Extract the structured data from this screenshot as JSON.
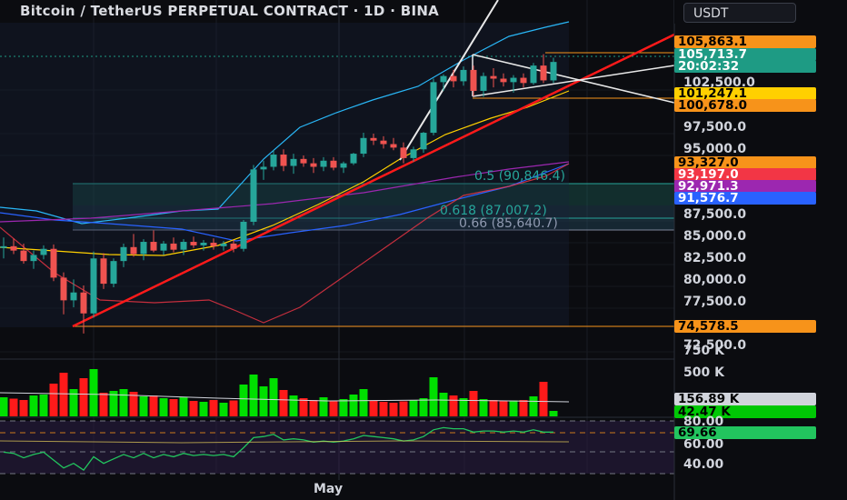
{
  "title": "Bitcoin / TetherUS PERPETUAL CONTRACT · 1D · BINA",
  "currency_button": "USDT",
  "x_labels": [
    "May"
  ],
  "fib_labels": [
    {
      "text": "0.5 (90,846.4)",
      "color": "#26a69a"
    },
    {
      "text": "0.618 (87,007.2)",
      "color": "#26a69a"
    },
    {
      "text": "0.66 (85,640.7)",
      "color": "#8f99b0"
    }
  ],
  "price_axis": {
    "ticks": [
      "102,500.0",
      "97,500.0",
      "95,000.0",
      "87,500.0",
      "85,000.0",
      "82,500.0",
      "80,000.0",
      "77,500.0",
      "72,500.0"
    ],
    "tags": [
      {
        "text": "105,863.1",
        "bg": "#f7931a",
        "fg": "#000000"
      },
      {
        "text": "105,713.7",
        "bg": "#1e9b84",
        "fg": "#ffffff"
      },
      {
        "text": "20:02:32",
        "bg": "#1e9b84",
        "fg": "#ffffff"
      },
      {
        "text": "101,247.1",
        "bg": "#ffd000",
        "fg": "#000000"
      },
      {
        "text": "100,678.0",
        "bg": "#f7931a",
        "fg": "#000000"
      },
      {
        "text": "93,327.0",
        "bg": "#f7931a",
        "fg": "#000000"
      },
      {
        "text": "93,197.0",
        "bg": "#f23645",
        "fg": "#ffffff"
      },
      {
        "text": "92,971.3",
        "bg": "#9c27b0",
        "fg": "#ffffff"
      },
      {
        "text": "91,576.7",
        "bg": "#2962ff",
        "fg": "#ffffff"
      },
      {
        "text": "74,578.5",
        "bg": "#f7931a",
        "fg": "#000000"
      }
    ]
  },
  "volume_axis": {
    "ticks": [
      "750 K",
      "500 K"
    ],
    "tags": [
      {
        "text": "156.89 K",
        "bg": "#d1d4dc",
        "fg": "#000000"
      },
      {
        "text": "42.47 K",
        "bg": "#00c805",
        "fg": "#000000"
      }
    ]
  },
  "rsi_axis": {
    "ticks": [
      "80.00",
      "60.00",
      "40.00"
    ],
    "tags": [
      {
        "text": "69.66",
        "bg": "#22c55e",
        "fg": "#000000"
      }
    ]
  },
  "chart_data": {
    "type": "candlestick",
    "title": "Bitcoin / TetherUS PERPETUAL CONTRACT · 1D · BINA",
    "y_unit": "USDT",
    "ylim": [
      72500,
      108000
    ],
    "candles": [
      [
        84400,
        85600,
        83200,
        84600
      ],
      [
        84600,
        85500,
        83700,
        84100
      ],
      [
        84100,
        84900,
        82600,
        82900
      ],
      [
        82900,
        84100,
        82000,
        83600
      ],
      [
        83600,
        84700,
        83100,
        84300
      ],
      [
        84300,
        84800,
        80600,
        81000
      ],
      [
        81000,
        81600,
        76800,
        78400
      ],
      [
        78400,
        80800,
        77600,
        79300
      ],
      [
        79300,
        80100,
        74600,
        76900
      ],
      [
        76900,
        84000,
        76400,
        83200
      ],
      [
        83200,
        83800,
        79700,
        80300
      ],
      [
        80300,
        83200,
        79900,
        82900
      ],
      [
        82900,
        84900,
        82200,
        84500
      ],
      [
        84500,
        86000,
        83400,
        83700
      ],
      [
        83700,
        85400,
        83000,
        85100
      ],
      [
        85100,
        86400,
        83900,
        84100
      ],
      [
        84100,
        85200,
        83600,
        84900
      ],
      [
        84900,
        85600,
        83900,
        84200
      ],
      [
        84200,
        85400,
        83600,
        85100
      ],
      [
        85100,
        85700,
        84400,
        84700
      ],
      [
        84700,
        85300,
        84100,
        85000
      ],
      [
        85000,
        85500,
        84200,
        84600
      ],
      [
        84600,
        85200,
        84100,
        84900
      ],
      [
        84900,
        85300,
        83900,
        84300
      ],
      [
        84300,
        87600,
        84000,
        87400
      ],
      [
        87400,
        93900,
        87000,
        93400
      ],
      [
        93400,
        94400,
        92200,
        93700
      ],
      [
        93700,
        95600,
        93300,
        95100
      ],
      [
        95100,
        95700,
        93200,
        93800
      ],
      [
        93800,
        95200,
        92900,
        94600
      ],
      [
        94600,
        95000,
        93700,
        94100
      ],
      [
        94100,
        94700,
        93000,
        93700
      ],
      [
        93700,
        94800,
        93200,
        94400
      ],
      [
        94400,
        94800,
        93300,
        93600
      ],
      [
        93600,
        94300,
        93000,
        94100
      ],
      [
        94100,
        95300,
        93900,
        95200
      ],
      [
        95200,
        97600,
        94800,
        97000
      ],
      [
        97000,
        97500,
        96200,
        96700
      ],
      [
        96700,
        97200,
        95800,
        96300
      ],
      [
        96300,
        97000,
        95600,
        95900
      ],
      [
        95900,
        96500,
        94100,
        94700
      ],
      [
        94700,
        96000,
        94300,
        95700
      ],
      [
        95700,
        97700,
        95300,
        97600
      ],
      [
        97600,
        103800,
        97300,
        103400
      ],
      [
        103400,
        104300,
        102400,
        104100
      ],
      [
        104100,
        104800,
        102800,
        103500
      ],
      [
        103500,
        105200,
        103000,
        104800
      ],
      [
        104800,
        105300,
        101800,
        102400
      ],
      [
        102400,
        104500,
        101700,
        104100
      ],
      [
        104100,
        105000,
        102800,
        103800
      ],
      [
        103800,
        104400,
        102900,
        103400
      ],
      [
        103400,
        104200,
        102200,
        103900
      ],
      [
        103900,
        104400,
        102800,
        103300
      ],
      [
        103300,
        105600,
        103100,
        105300
      ],
      [
        105300,
        106600,
        103300,
        103600
      ],
      [
        103600,
        106200,
        103300,
        105714
      ]
    ],
    "volume": [
      210,
      195,
      180,
      230,
      240,
      360,
      480,
      300,
      420,
      520,
      260,
      280,
      300,
      270,
      220,
      230,
      200,
      190,
      210,
      170,
      160,
      180,
      150,
      175,
      350,
      460,
      330,
      420,
      290,
      230,
      200,
      180,
      210,
      170,
      190,
      240,
      300,
      170,
      160,
      150,
      165,
      175,
      200,
      430,
      260,
      230,
      200,
      280,
      190,
      180,
      170,
      175,
      180,
      220,
      380,
      60
    ],
    "rsi": [
      52,
      51,
      47,
      50,
      52,
      45,
      38,
      42,
      36,
      48,
      42,
      46,
      50,
      47,
      51,
      47,
      50,
      48,
      51,
      49,
      50,
      49,
      50,
      48,
      56,
      65,
      66,
      68,
      63,
      64,
      63,
      61,
      62,
      61,
      62,
      64,
      67,
      66,
      65,
      64,
      62,
      63,
      66,
      72,
      74,
      73,
      73,
      70,
      71,
      71,
      70,
      71,
      70,
      72,
      70,
      70
    ]
  }
}
